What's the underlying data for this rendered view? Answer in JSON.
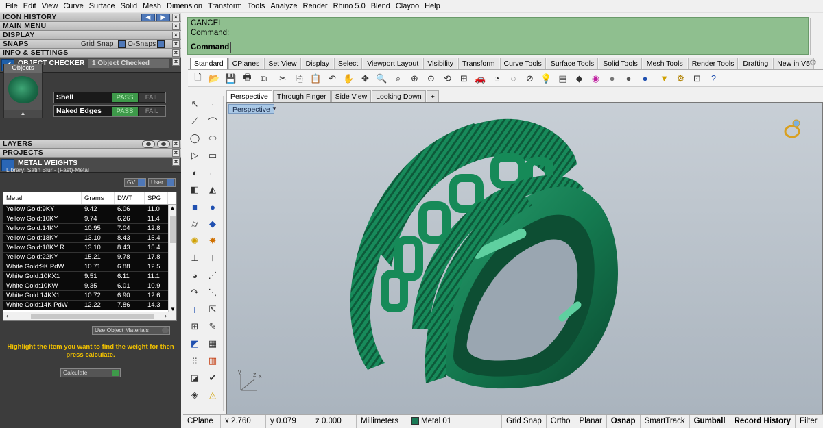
{
  "menu": [
    "File",
    "Edit",
    "View",
    "Curve",
    "Surface",
    "Solid",
    "Mesh",
    "Dimension",
    "Transform",
    "Tools",
    "Analyze",
    "Render",
    "Rhino 5.0",
    "Blend",
    "Clayoo",
    "Help"
  ],
  "panel": {
    "icon_history": "ICON HISTORY",
    "main_menu": "MAIN MENU",
    "display": "DISPLAY",
    "snaps": "SNAPS",
    "grid_snap": "Grid Snap",
    "o_snaps": "O-Snaps",
    "info_settings": "INFO & SETTINGS",
    "object_checker": "OBJECT CHECKER",
    "objects_checked": "1 Object Checked",
    "objects_label": "Objects",
    "checks": [
      {
        "name": "Shell",
        "pass": "PASS",
        "fail": "FAIL"
      },
      {
        "name": "Naked Edges",
        "pass": "PASS",
        "fail": "FAIL"
      }
    ],
    "layers": "LAYERS",
    "projects": "PROJECTS",
    "metal_weights": "METAL WEIGHTS",
    "library": "Library: Satin Blur - (Fast)-Metal",
    "gv": "GV",
    "user": "User",
    "columns": [
      "Metal",
      "Grams",
      "DWT",
      "SPG"
    ],
    "rows": [
      [
        "Yellow Gold:9KY",
        "9.42",
        "6.06",
        "11.0"
      ],
      [
        "Yellow Gold:10KY",
        "9.74",
        "6.26",
        "11.4"
      ],
      [
        "Yellow Gold:14KY",
        "10.95",
        "7.04",
        "12.8"
      ],
      [
        "Yellow Gold:18KY",
        "13.10",
        "8.43",
        "15.4"
      ],
      [
        "Yellow Gold:18KY R...",
        "13.10",
        "8.43",
        "15.4"
      ],
      [
        "Yellow Gold:22KY",
        "15.21",
        "9.78",
        "17.8"
      ],
      [
        "White Gold:9K PdW",
        "10.71",
        "6.88",
        "12.5"
      ],
      [
        "White Gold:10KX1",
        "9.51",
        "6.11",
        "11.1"
      ],
      [
        "White Gold:10KW",
        "9.35",
        "6.01",
        "10.9"
      ],
      [
        "White Gold:14KX1",
        "10.72",
        "6.90",
        "12.6"
      ],
      [
        "White Gold:14K PdW",
        "12.22",
        "7.86",
        "14.3"
      ]
    ],
    "use_object_materials": "Use Object Materials",
    "hint": "Highlight the item you want to find the weight for then press calculate.",
    "calculate": "Calculate"
  },
  "command": {
    "line1": "CANCEL",
    "line2": "Command:",
    "prompt": "Command:"
  },
  "toolbar_tabs": [
    "Standard",
    "CPlanes",
    "Set View",
    "Display",
    "Select",
    "Viewport Layout",
    "Visibility",
    "Transform",
    "Curve Tools",
    "Surface Tools",
    "Solid Tools",
    "Mesh Tools",
    "Render Tools",
    "Drafting",
    "New in V5"
  ],
  "viewport_tabs": [
    "Perspective",
    "Through Finger",
    "Side View",
    "Looking Down"
  ],
  "viewport": {
    "label": "Perspective"
  },
  "status": {
    "cplane": "CPlane",
    "x": "x 2.760",
    "y": "y 0.079",
    "z": "z 0.000",
    "units": "Millimeters",
    "layer": "Metal 01",
    "items": [
      "Grid Snap",
      "Ortho",
      "Planar",
      "Osnap",
      "SmartTrack",
      "Gumball",
      "Record History",
      "Filter"
    ]
  }
}
